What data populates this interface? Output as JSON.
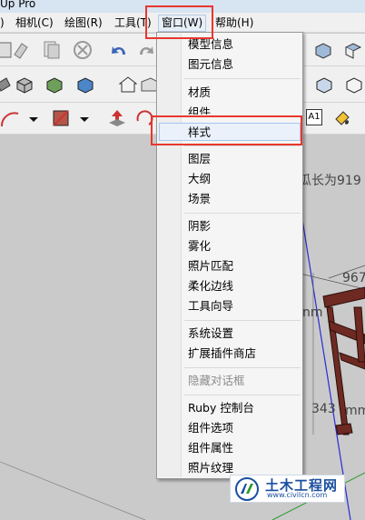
{
  "window": {
    "title": "Up Pro"
  },
  "menubar": {
    "items": [
      ")",
      "相机(C)",
      "绘图(R)",
      "工具(T)",
      "窗口(W)",
      "帮助(H)"
    ]
  },
  "dropdown": {
    "items": [
      {
        "label": "模型信息",
        "disabled": false
      },
      {
        "label": "图元信息",
        "disabled": false
      },
      {
        "label": "材质",
        "disabled": false
      },
      {
        "label": "组件",
        "disabled": false
      },
      {
        "label": "样式",
        "disabled": false,
        "highlighted": true
      },
      {
        "label": "图层",
        "disabled": false
      },
      {
        "label": "大纲",
        "disabled": false
      },
      {
        "label": "场景",
        "disabled": false
      },
      {
        "label": "阴影",
        "disabled": false
      },
      {
        "label": "雾化",
        "disabled": false
      },
      {
        "label": "照片匹配",
        "disabled": false
      },
      {
        "label": "柔化边线",
        "disabled": false
      },
      {
        "label": "工具向导",
        "disabled": false
      },
      {
        "label": "系统设置",
        "disabled": false
      },
      {
        "label": "扩展插件商店",
        "disabled": false
      },
      {
        "label": "隐藏对话框",
        "disabled": true
      },
      {
        "label": "Ruby 控制台",
        "disabled": false
      },
      {
        "label": "组件选项",
        "disabled": false
      },
      {
        "label": "组件属性",
        "disabled": false
      },
      {
        "label": "照片纹理",
        "disabled": false
      }
    ]
  },
  "viewport": {
    "texts": [
      "瓜长为919",
      "967",
      "nm",
      "343",
      "mm"
    ]
  },
  "toolbar": {
    "text_tool_label": "A1"
  },
  "watermark": {
    "title": "土木工程网",
    "url": "www.civilcn.com"
  },
  "colors": {
    "highlight_box": "#e8372e",
    "axis_blue": "#2b2bd6",
    "axis_green": "#2e9a2e",
    "frame_brown": "#6e2a22"
  }
}
